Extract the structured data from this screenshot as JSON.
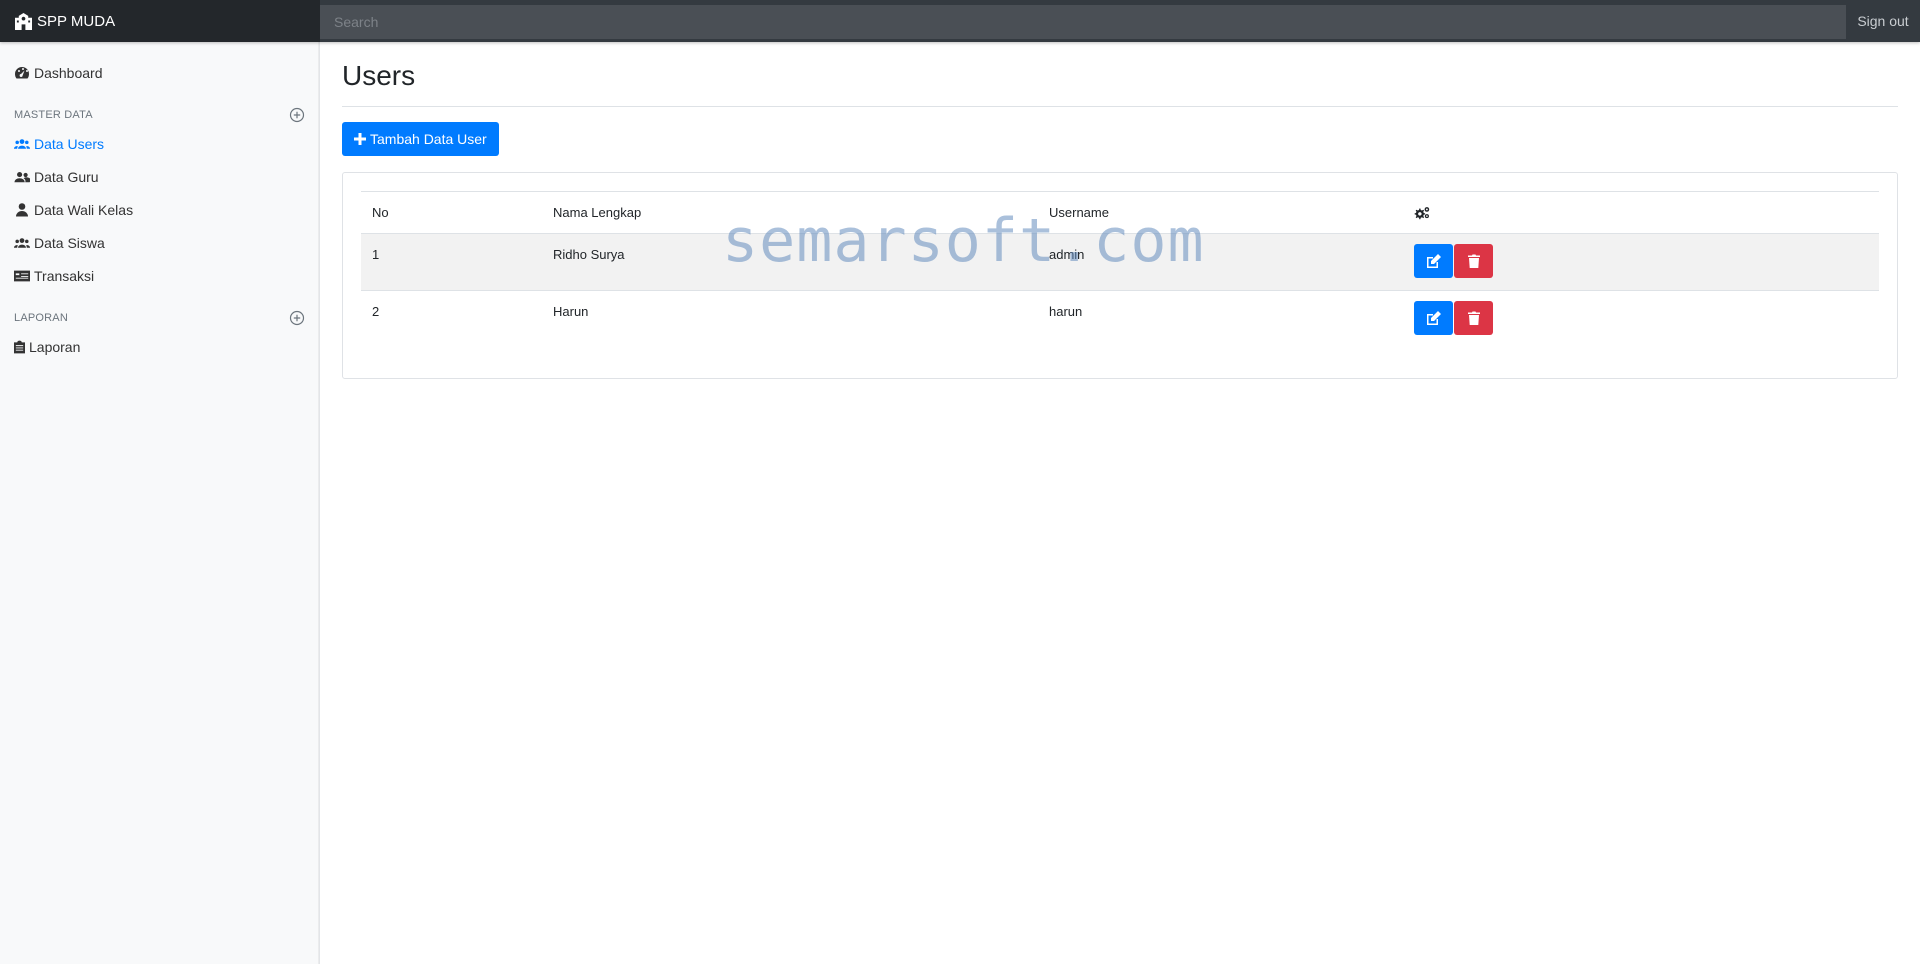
{
  "navbar": {
    "brand": "SPP MUDA",
    "search_placeholder": "Search",
    "signout": "Sign out"
  },
  "sidebar": {
    "dashboard": "Dashboard",
    "section_master": "MASTER DATA",
    "items_master": [
      {
        "label": "Data Users",
        "icon": "users-icon",
        "active": true
      },
      {
        "label": "Data Guru",
        "icon": "user-friends-icon"
      },
      {
        "label": "Data Wali Kelas",
        "icon": "user-tie-icon"
      },
      {
        "label": "Data Siswa",
        "icon": "users-icon"
      },
      {
        "label": "Transaksi",
        "icon": "money-check-icon"
      }
    ],
    "section_laporan": "LAPORAN",
    "laporan": "Laporan"
  },
  "main": {
    "title": "Users",
    "add_button": "Tambah Data User",
    "table": {
      "headers": [
        "No",
        "Nama Lengkap",
        "Username"
      ],
      "rows": [
        {
          "no": "1",
          "nama": "Ridho Surya",
          "username": "admin"
        },
        {
          "no": "2",
          "nama": "Harun",
          "username": "harun"
        }
      ]
    }
  },
  "watermark": "semarsoft.com",
  "colors": {
    "primary": "#007bff",
    "danger": "#dc3545",
    "navbar": "#343a40"
  }
}
